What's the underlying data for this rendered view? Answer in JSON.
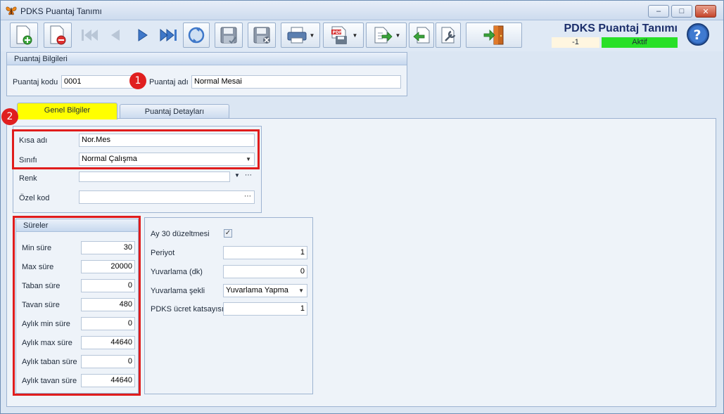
{
  "window": {
    "title": "PDKS Puantaj Tanımı",
    "icon": "butterfly-icon"
  },
  "header": {
    "form_title": "PDKS Puantaj Tanımı",
    "record_id": "-1",
    "status": "Aktif",
    "status_color": "#28e028"
  },
  "toolbar": {
    "buttons": [
      {
        "icon": "new-record-icon"
      },
      {
        "icon": "delete-record-icon"
      },
      {
        "icon": "first-record-icon"
      },
      {
        "icon": "previous-record-icon"
      },
      {
        "icon": "next-record-icon"
      },
      {
        "icon": "last-record-icon"
      },
      {
        "icon": "refresh-icon"
      },
      {
        "icon": "save-icon"
      },
      {
        "icon": "save-close-icon"
      },
      {
        "icon": "print-icon"
      },
      {
        "icon": "pdf-export-icon"
      },
      {
        "icon": "export-icon"
      },
      {
        "icon": "import-icon"
      },
      {
        "icon": "settings-wrench-icon"
      },
      {
        "icon": "exit-door-icon"
      }
    ]
  },
  "puantaj_bilgileri": {
    "caption": "Puantaj Bilgileri",
    "kod_label": "Puantaj kodu",
    "kod_value": "0001",
    "ad_label": "Puantaj adı",
    "ad_value": "Normal Mesai"
  },
  "tabs": [
    {
      "label": "Genel Bilgiler",
      "active": true
    },
    {
      "label": "Puantaj Detayları",
      "active": false
    }
  ],
  "genel": {
    "kisa_adi_label": "Kısa adı",
    "kisa_adi_value": "Nor.Mes",
    "sinifi_label": "Sınıfı",
    "sinifi_value": "Normal Çalışma",
    "renk_label": "Renk",
    "renk_value": "",
    "ozel_kod_label": "Özel kod",
    "ozel_kod_value": ""
  },
  "sureler": {
    "caption": "Süreler",
    "rows": [
      {
        "label": "Min süre",
        "value": "30"
      },
      {
        "label": "Max süre",
        "value": "20000"
      },
      {
        "label": "Taban süre",
        "value": "0"
      },
      {
        "label": "Tavan süre",
        "value": "480"
      },
      {
        "label": "Aylık min süre",
        "value": "0"
      },
      {
        "label": "Aylık max süre",
        "value": "44640"
      },
      {
        "label": "Aylık taban süre",
        "value": "0"
      },
      {
        "label": "Aylık tavan süre",
        "value": "44640"
      }
    ]
  },
  "diger": {
    "ay30_label": "Ay 30 düzeltmesi",
    "ay30_checked": true,
    "periyot_label": "Periyot",
    "periyot_value": "1",
    "yuvarlama_label": "Yuvarlama (dk)",
    "yuvarlama_value": "0",
    "yuvarlama_sekli_label": "Yuvarlama şekli",
    "yuvarlama_sekli_value": "Yuvarlama Yapma",
    "ucret_label": "PDKS ücret katsayısı",
    "ucret_value": "1"
  },
  "annotations": {
    "marker1": "1",
    "marker2": "2"
  }
}
